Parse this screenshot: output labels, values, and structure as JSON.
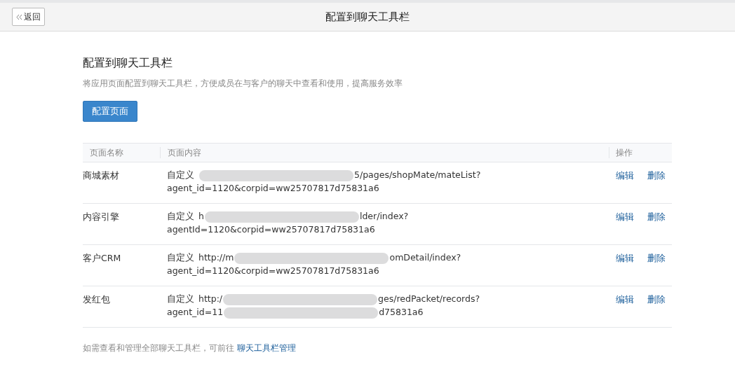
{
  "header": {
    "back_button": "返回",
    "title": "配置到聊天工具栏"
  },
  "section": {
    "title": "配置到聊天工具栏",
    "description": "将应用页面配置到聊天工具栏，方便成员在与客户的聊天中查看和使用，提高服务效率",
    "primary_button": "配置页面"
  },
  "table": {
    "columns": [
      "页面名称",
      "页面内容",
      "操作"
    ],
    "rows": [
      {
        "name": "商城素材",
        "type": "自定义",
        "line1": {
          "after": "5/pages/shopMate/mateList?"
        },
        "line2": {
          "before": "agent_id=1120&corpid=ww25707817d75831a6"
        },
        "actions": [
          "编辑",
          "删除"
        ]
      },
      {
        "name": "内容引擎",
        "type": "自定义",
        "line1": {
          "before": "h",
          "after": "lder/index?"
        },
        "line2": {
          "before": "agentId=1120&corpid=ww25707817d75831a6"
        },
        "actions": [
          "编辑",
          "删除"
        ]
      },
      {
        "name": "客户CRM",
        "type": "自定义",
        "line1": {
          "before": "http://m",
          "after": "omDetail/index?"
        },
        "line2": {
          "before": "agent_id=1120&corpid=ww25707817d75831a6"
        },
        "actions": [
          "编辑",
          "删除"
        ]
      },
      {
        "name": "发红包",
        "type": "自定义",
        "line1": {
          "before": "http:/",
          "after": "ges/redPacket/records?"
        },
        "line2": {
          "before": "agent_id=11",
          "after": "d75831a6"
        },
        "actions": [
          "编辑",
          "删除"
        ]
      }
    ]
  },
  "footer": {
    "text": "如需查看和管理全部聊天工具栏，可前往",
    "link": "聊天工具栏管理"
  }
}
